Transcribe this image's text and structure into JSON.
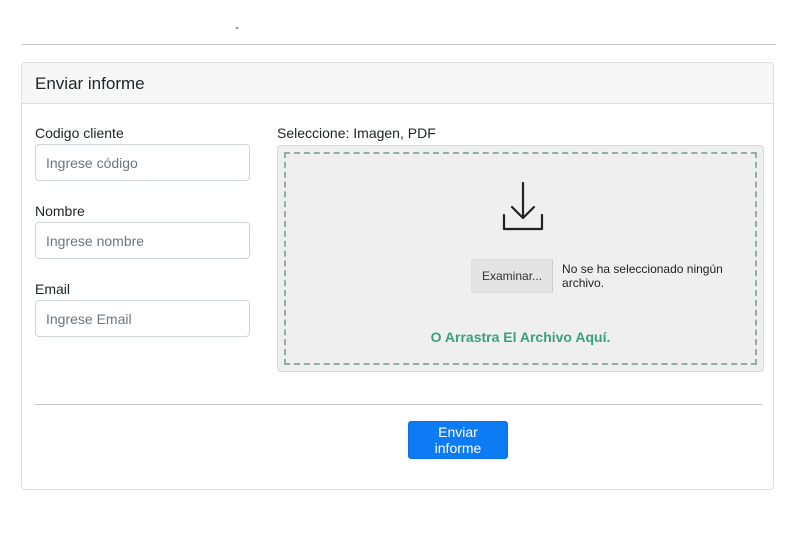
{
  "top": {
    "mark": "-"
  },
  "card": {
    "title": "Enviar informe"
  },
  "form": {
    "code": {
      "label": "Codigo cliente",
      "placeholder": "Ingrese código"
    },
    "name": {
      "label": "Nombre",
      "placeholder": "Ingrese nombre"
    },
    "email": {
      "label": "Email",
      "placeholder": "Ingrese Email"
    }
  },
  "upload": {
    "label": "Seleccione: Imagen, PDF",
    "icon": "download-icon",
    "browse_label": "Examinar...",
    "file_status": "No se ha seleccionado ningún archivo.",
    "drop_hint": "O Arrastra El Archivo Aquí.",
    "hint_color": "#3aa17e"
  },
  "submit": {
    "label": "Enviar informe",
    "color": "#0d7bf4"
  }
}
